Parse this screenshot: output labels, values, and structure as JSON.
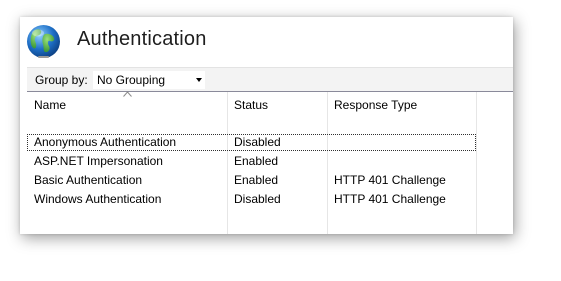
{
  "header": {
    "title": "Authentication",
    "icon": "globe-icon"
  },
  "group_by": {
    "label": "Group by:",
    "value": "No Grouping"
  },
  "table": {
    "columns": [
      "Name",
      "Status",
      "Response Type"
    ],
    "sort_column": "Name",
    "rows": [
      {
        "name": "Anonymous Authentication",
        "status": "Disabled",
        "response_type": "",
        "selected": true
      },
      {
        "name": "ASP.NET Impersonation",
        "status": "Enabled",
        "response_type": ""
      },
      {
        "name": "Basic Authentication",
        "status": "Enabled",
        "response_type": "HTTP 401 Challenge"
      },
      {
        "name": "Windows Authentication",
        "status": "Disabled",
        "response_type": "HTTP 401 Challenge"
      }
    ]
  },
  "colors": {
    "separator": "#8a8a9a",
    "group_bar": "#f3f3f3",
    "globe_ocean": "#1e6fc7",
    "globe_land": "#3aa83a"
  }
}
